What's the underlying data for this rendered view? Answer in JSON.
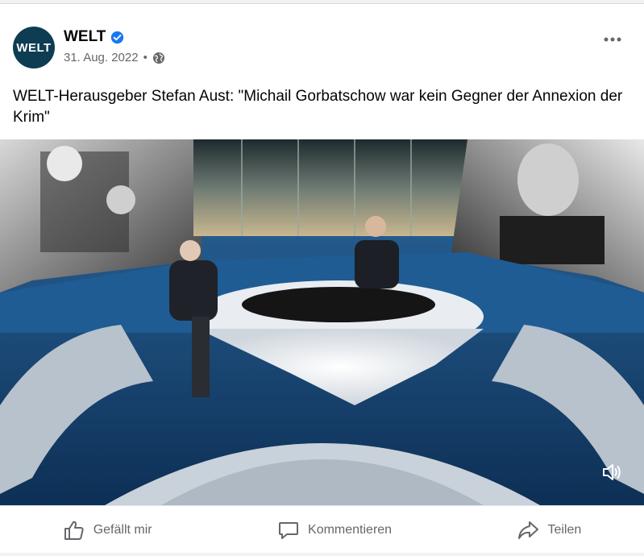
{
  "post": {
    "page_name": "WELT",
    "avatar_text": "WELT",
    "date": "31. Aug. 2022",
    "separator": "•",
    "audience_icon": "globe-icon",
    "caption": "WELT-Herausgeber Stefan Aust: \"Michail Gorbatschow war kein Gegner der Annexion der Krim\""
  },
  "actions": {
    "like_label": "Gefällt mir",
    "comment_label": "Kommentieren",
    "share_label": "Teilen"
  },
  "colors": {
    "avatar_bg": "#0e3c52",
    "verified_badge": "#1877f2",
    "secondary_text": "#65676b"
  }
}
